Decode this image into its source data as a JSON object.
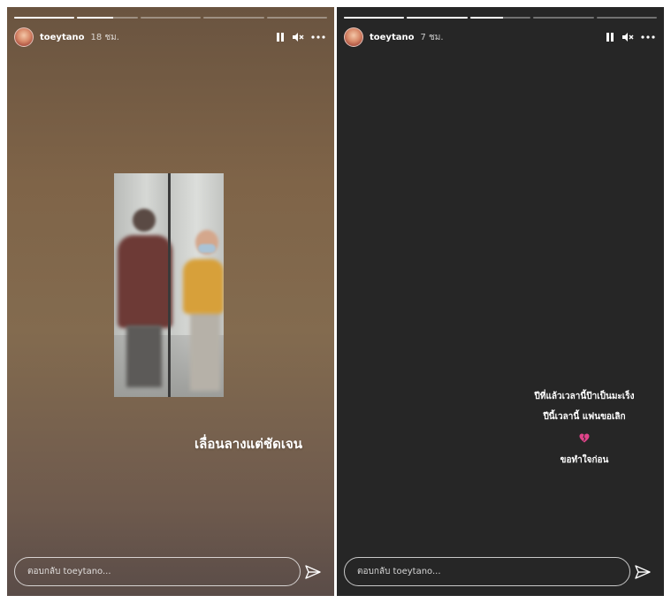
{
  "stories": [
    {
      "username": "toeytano",
      "time_ago": "18 ชม.",
      "progress": [
        1,
        0.6,
        0,
        0,
        0
      ],
      "caption": "เลื่อนลางแต่ชัดเจน",
      "reply_placeholder": "ตอบกลับ toeytano..."
    },
    {
      "username": "toeytano",
      "time_ago": "7 ชม.",
      "progress": [
        1,
        1,
        0.55,
        0,
        0
      ],
      "lines": [
        "ปีที่แล้วเวลานี้ป๊าเป็นมะเร็ง",
        "ปีนี้เวลานี้ แฟนขอเลิก",
        "ขอทำใจก่อน"
      ],
      "reply_placeholder": "ตอบกลับ toeytano..."
    }
  ],
  "icons": {
    "pause": "pause-icon",
    "mute": "speaker-muted-icon",
    "more": "more-dots-icon",
    "heart": "broken-heart-icon",
    "send": "paper-plane-icon"
  },
  "colors": {
    "left_background": "#7f6448",
    "right_background": "#262626",
    "heart": "#e0448a"
  }
}
